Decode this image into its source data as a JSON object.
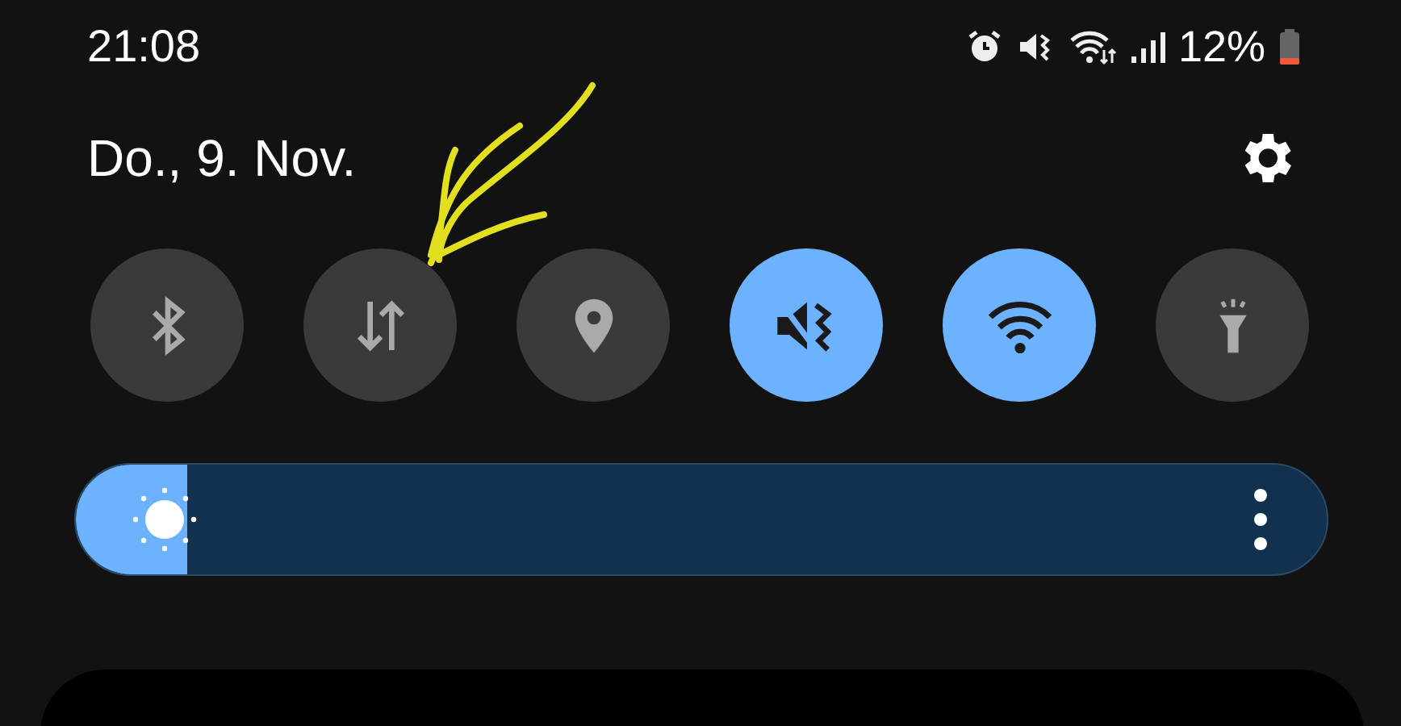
{
  "status_bar": {
    "time": "21:08",
    "battery": "12%"
  },
  "header": {
    "date": "Do., 9. Nov."
  },
  "tiles": [
    {
      "kind": "bluetooth",
      "on": false
    },
    {
      "kind": "data",
      "on": false
    },
    {
      "kind": "location",
      "on": false
    },
    {
      "kind": "mute",
      "on": true
    },
    {
      "kind": "wifi",
      "on": true
    },
    {
      "kind": "flashlight",
      "on": false
    }
  ],
  "brightness": {
    "level": 0.04
  }
}
